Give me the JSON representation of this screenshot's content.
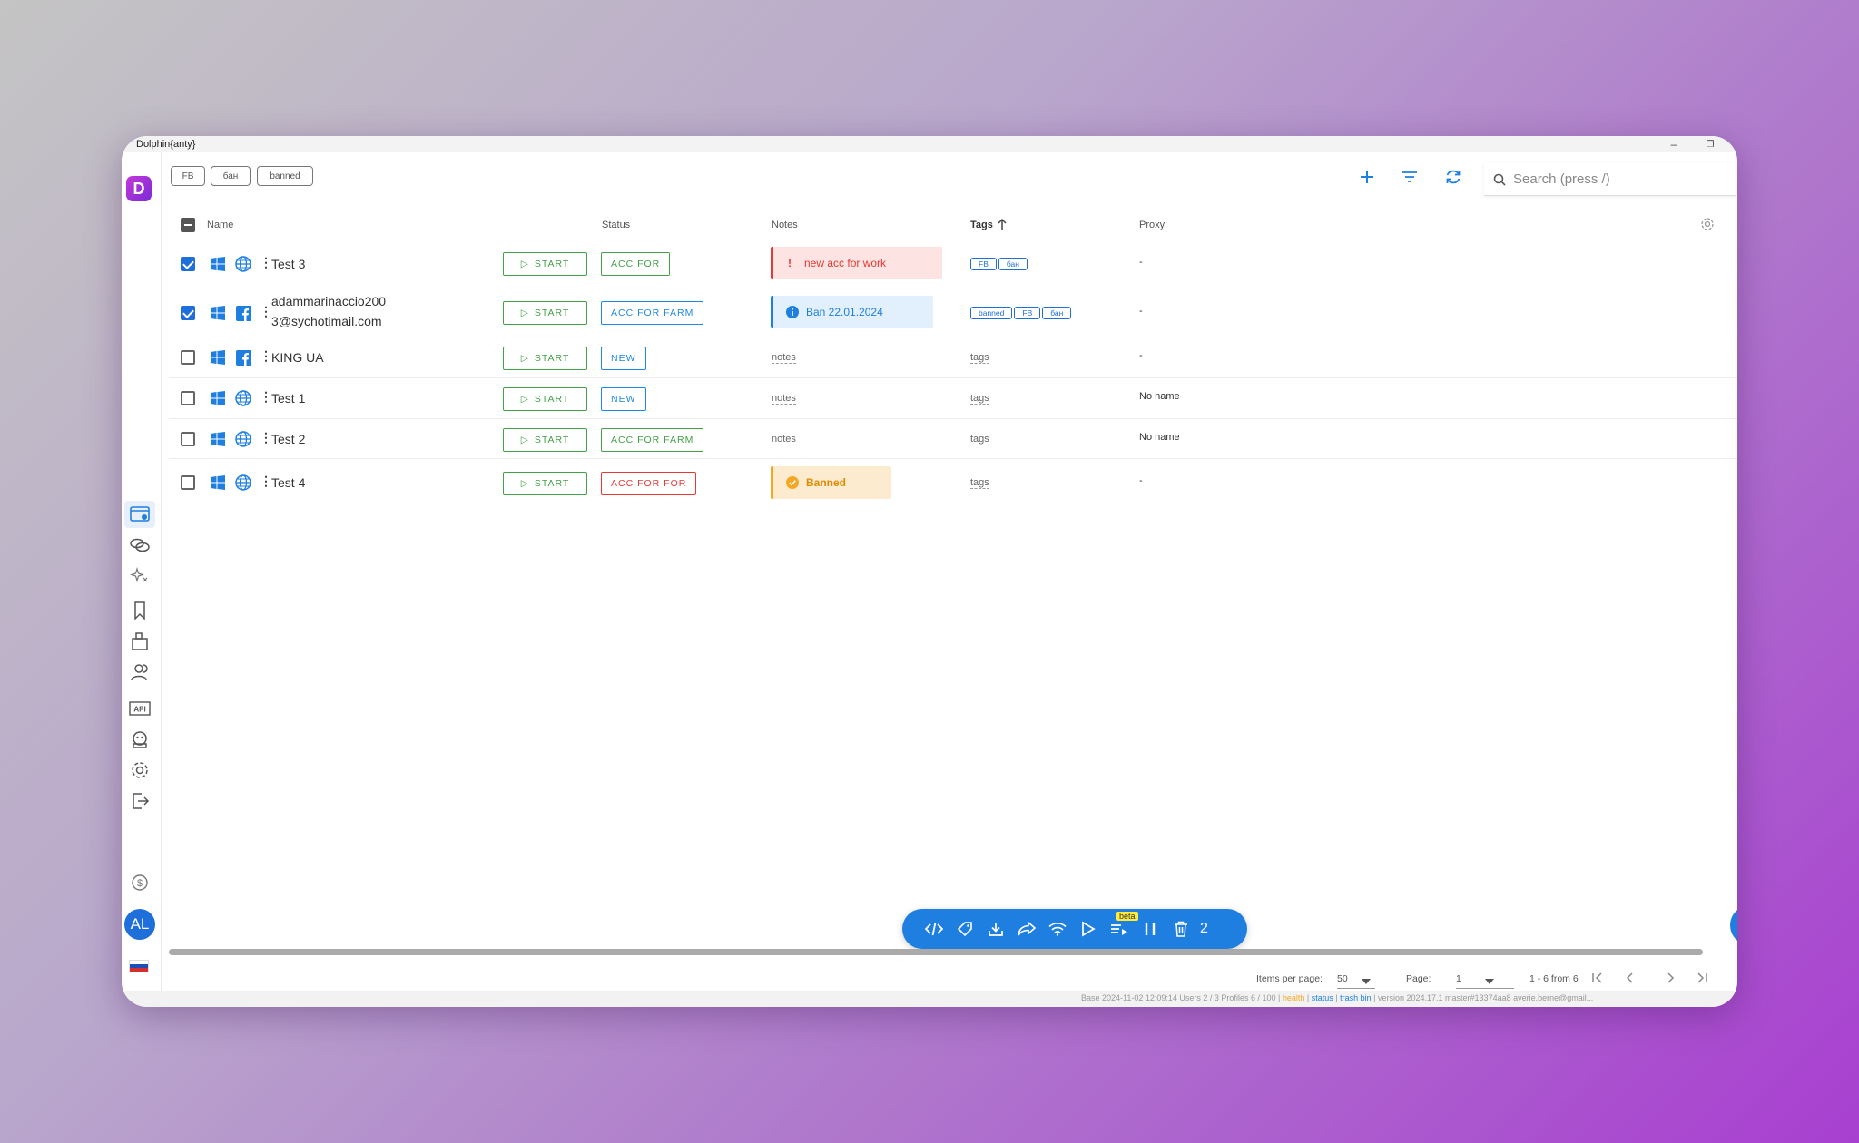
{
  "app": {
    "title": "Dolphin{anty}",
    "logo_letter": "D"
  },
  "window_controls": {
    "minimize": "–",
    "maximize": "❐",
    "close": "⌃"
  },
  "sidebar": {
    "nav_icons": [
      "browser-profiles-icon",
      "link-icon",
      "sparkle-icon",
      "bookmark-icon",
      "extensions-icon",
      "users-icon",
      "api-icon",
      "bot-icon",
      "settings-icon",
      "logout-icon"
    ],
    "billing_icon": "dollar-icon",
    "avatar": "AL",
    "flag": [
      "#ffffff",
      "#1e4fb8",
      "#d32f2f"
    ]
  },
  "filter_chips": [
    "FB",
    "бан",
    "banned"
  ],
  "search": {
    "placeholder": "Search (press /)"
  },
  "table": {
    "headers": {
      "name": "Name",
      "status": "Status",
      "notes": "Notes",
      "tags": "Tags",
      "proxy": "Proxy"
    },
    "start_label": "START",
    "ghost_notes": "notes",
    "ghost_tags": "tags",
    "rows": [
      {
        "checked": true,
        "browser_icon": "globe-icon",
        "name": "Test 3",
        "status": "ACC FOR",
        "status_color": "#43a047",
        "note": "new acc for work",
        "note_kind": "error",
        "tags": [
          "FB",
          "бан"
        ],
        "proxy": "-"
      },
      {
        "checked": true,
        "browser_icon": "facebook-icon",
        "name_line1": "adammarinaccio200",
        "name_line2": "3@sychotimail.com",
        "status": "ACC FOR FARM",
        "status_color": "#1e88e5",
        "note": "Ban 22.01.2024",
        "note_kind": "info",
        "tags": [
          "banned",
          "FB",
          "бан"
        ],
        "proxy": "-"
      },
      {
        "checked": false,
        "browser_icon": "facebook-icon",
        "name": "KING UA",
        "status": "NEW",
        "status_color": "#1e88e5",
        "proxy": "-"
      },
      {
        "checked": false,
        "browser_icon": "globe-icon",
        "name": "Test 1",
        "status": "NEW",
        "status_color": "#1e88e5",
        "proxy": "No name"
      },
      {
        "checked": false,
        "browser_icon": "globe-icon",
        "name": "Test 2",
        "status": "ACC FOR FARM",
        "status_color": "#43a047",
        "proxy": "No name"
      },
      {
        "checked": false,
        "browser_icon": "globe-icon",
        "name": "Test 4",
        "status": "ACC FOR FOR",
        "status_color": "#e53935",
        "note": "Banned",
        "note_kind": "warning",
        "proxy": "-"
      }
    ]
  },
  "bulk_actions": {
    "beta": "beta",
    "count": "2"
  },
  "pagination": {
    "items_per_page_label": "Items per page:",
    "items_per_page": "50",
    "page_label": "Page:",
    "page": "1",
    "range": "1 - 6 from 6"
  },
  "footer": {
    "text": "Base   2024-11-02 12:09:14   Users 2 / 3   Profiles 6 / 100",
    "health": "health",
    "status": "status",
    "trash": "trash bin",
    "version": "version 2024.17.1   master#13374aa8   averie.berne@gmail..."
  },
  "colors": {
    "accent": "#1e7fe0",
    "start": "#43a047",
    "danger": "#e53935"
  }
}
